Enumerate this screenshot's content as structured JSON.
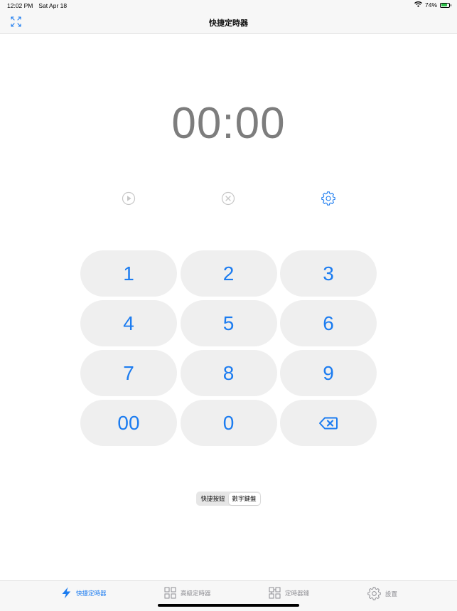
{
  "status_bar": {
    "time": "12:02 PM",
    "date": "Sat Apr 18",
    "battery": "74%",
    "battery_level": 0.74,
    "battery_color": "#2ec04b"
  },
  "nav": {
    "title": "快捷定時器",
    "left_icon": "expand-arrows-icon"
  },
  "timer": {
    "display": "00:00",
    "color": "#7d7d7d"
  },
  "controls": {
    "play_icon": "play-circle-icon",
    "cancel_icon": "x-circle-icon",
    "settings_icon": "gear-icon"
  },
  "keypad": {
    "keys": [
      "1",
      "2",
      "3",
      "4",
      "5",
      "6",
      "7",
      "8",
      "9",
      "00",
      "0"
    ],
    "delete_icon": "delete-backspace-icon",
    "key_color": "#1c7cf0",
    "key_background": "#efefef"
  },
  "segmented": {
    "options": [
      "快捷按鈕",
      "數字鍵盤"
    ],
    "selected": "數字鍵盤"
  },
  "tab_bar": {
    "tabs": [
      {
        "label": "快捷定時器",
        "icon": "bolt-icon",
        "active": true
      },
      {
        "label": "高級定時器",
        "icon": "grid-icon",
        "active": false
      },
      {
        "label": "定時器鏈",
        "icon": "chain-grid-icon",
        "active": false
      },
      {
        "label": "設置",
        "icon": "gear-icon",
        "active": false
      }
    ],
    "active_color": "#1c7cf0",
    "inactive_color": "#8e8e93"
  }
}
